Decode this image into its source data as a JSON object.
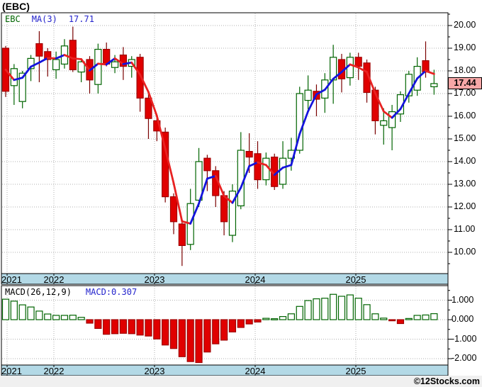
{
  "title": "(EBC)",
  "watermark": "©12Stocks.com",
  "main_chart": {
    "legend": {
      "symbol": "EBC",
      "ma_label": "MA(3)",
      "ma_value": "17.71"
    },
    "last_price_tag": "17.44",
    "price_axis": {
      "values": [
        20,
        19,
        18,
        17,
        16,
        15,
        14,
        13,
        12,
        11,
        10
      ],
      "labels": [
        "20.00",
        "19.00",
        "18.00",
        "17.00",
        "16.00",
        "15.00",
        "14.00",
        "13.00",
        "12.00",
        "11.00",
        "10.00"
      ]
    }
  },
  "macd_panel": {
    "legend": {
      "label": "MACD(26,12,9)",
      "value_label": "MACD:0.307"
    },
    "axis": {
      "values": [
        1,
        0,
        -1,
        -2
      ],
      "labels": [
        "1.000",
        "0.000",
        "-1.000",
        "-2.000"
      ]
    }
  },
  "x_axis": {
    "years": [
      "2021",
      "2022",
      "2023",
      "2024",
      "2025"
    ]
  },
  "colors": {
    "up_candle": "#006400",
    "down_candle": "#e00000",
    "down_candle_border": "#a00000",
    "down_wick": "#7a0000",
    "ma_up": "#1414dc",
    "ma_down": "#e82222",
    "band_bg": "#b3d9e6",
    "tag_bg": "#f6a7a7",
    "grid": "#b0b0b0",
    "legend_symbol": "#006600",
    "legend_blue": "#2222cc"
  },
  "chart_data": {
    "type": "candlestick+macd-bar",
    "title": "(EBC)",
    "ma_period": 3,
    "ma_last": 17.71,
    "macd_last": 0.307,
    "price_axis_range": [
      10,
      20
    ],
    "macd_axis_range": [
      -2,
      1
    ],
    "grid": "dotted",
    "months": [
      "2021-07",
      "2021-08",
      "2021-09",
      "2021-10",
      "2021-11",
      "2021-12",
      "2022-01",
      "2022-02",
      "2022-03",
      "2022-04",
      "2022-05",
      "2022-06",
      "2022-07",
      "2022-08",
      "2022-09",
      "2022-10",
      "2022-11",
      "2022-12",
      "2023-01",
      "2023-02",
      "2023-03",
      "2023-04",
      "2023-05",
      "2023-06",
      "2023-07",
      "2023-08",
      "2023-09",
      "2023-10",
      "2023-11",
      "2023-12",
      "2024-01",
      "2024-02",
      "2024-03",
      "2024-04",
      "2024-05",
      "2024-06",
      "2024-07",
      "2024-08",
      "2024-09",
      "2024-10",
      "2024-11",
      "2024-12",
      "2025-01",
      "2025-02",
      "2025-03",
      "2025-04",
      "2025-05",
      "2025-06",
      "2025-07",
      "2025-08",
      "2025-09",
      "2025-10"
    ],
    "ohlc": [
      [
        19.0,
        19.1,
        16.85,
        17.1
      ],
      [
        17.35,
        18.3,
        16.5,
        18.1
      ],
      [
        16.65,
        18.0,
        16.35,
        17.9
      ],
      [
        18.1,
        18.7,
        17.55,
        18.55
      ],
      [
        19.2,
        19.75,
        17.5,
        18.65
      ],
      [
        18.85,
        19.0,
        17.75,
        18.5
      ],
      [
        18.05,
        18.85,
        17.65,
        18.5
      ],
      [
        18.3,
        19.4,
        18.1,
        19.1
      ],
      [
        19.35,
        19.95,
        17.95,
        18.05
      ],
      [
        17.95,
        18.55,
        17.5,
        18.4
      ],
      [
        18.5,
        18.65,
        17.0,
        17.6
      ],
      [
        17.4,
        19.2,
        17.0,
        18.95
      ],
      [
        18.95,
        19.25,
        18.2,
        18.3
      ],
      [
        18.15,
        18.7,
        17.9,
        18.4
      ],
      [
        18.7,
        19.05,
        17.6,
        18.2
      ],
      [
        18.2,
        18.65,
        17.7,
        18.5
      ],
      [
        18.6,
        18.75,
        16.2,
        16.8
      ],
      [
        16.8,
        17.1,
        15.0,
        15.9
      ],
      [
        15.8,
        16.1,
        14.9,
        15.35
      ],
      [
        15.3,
        15.5,
        12.2,
        12.45
      ],
      [
        12.45,
        12.6,
        10.8,
        11.35
      ],
      [
        11.25,
        11.4,
        9.4,
        10.3
      ],
      [
        10.35,
        12.8,
        10.1,
        12.15
      ],
      [
        12.3,
        14.6,
        12.0,
        14.0
      ],
      [
        14.15,
        14.3,
        12.7,
        13.6
      ],
      [
        13.6,
        13.8,
        12.0,
        12.5
      ],
      [
        12.5,
        12.7,
        10.75,
        11.35
      ],
      [
        10.75,
        13.0,
        10.45,
        12.7
      ],
      [
        12.05,
        15.3,
        11.9,
        14.5
      ],
      [
        14.45,
        15.25,
        13.5,
        14.2
      ],
      [
        14.35,
        14.9,
        12.8,
        13.2
      ],
      [
        13.2,
        14.4,
        12.95,
        14.15
      ],
      [
        14.2,
        14.35,
        12.75,
        12.9
      ],
      [
        13.0,
        14.9,
        12.8,
        14.15
      ],
      [
        14.15,
        15.05,
        13.6,
        14.5
      ],
      [
        14.5,
        17.3,
        14.35,
        17.0
      ],
      [
        16.7,
        17.8,
        16.3,
        17.15
      ],
      [
        17.1,
        17.4,
        16.0,
        16.75
      ],
      [
        16.8,
        17.9,
        16.15,
        17.6
      ],
      [
        17.6,
        19.15,
        16.55,
        18.6
      ],
      [
        18.5,
        18.75,
        17.05,
        17.65
      ],
      [
        17.7,
        18.8,
        17.35,
        18.6
      ],
      [
        18.6,
        18.8,
        17.6,
        18.2
      ],
      [
        18.35,
        18.5,
        16.6,
        17.05
      ],
      [
        17.15,
        17.3,
        15.2,
        15.8
      ],
      [
        15.6,
        16.35,
        14.75,
        15.8
      ],
      [
        15.5,
        16.5,
        14.5,
        16.2
      ],
      [
        16.1,
        17.1,
        15.75,
        16.95
      ],
      [
        16.9,
        18.0,
        16.6,
        17.85
      ],
      [
        17.15,
        18.6,
        16.9,
        18.2
      ],
      [
        18.45,
        19.3,
        17.7,
        17.95
      ],
      [
        17.3,
        18.05,
        16.95,
        17.44
      ]
    ],
    "macd": [
      1.05,
      0.95,
      0.76,
      0.65,
      0.44,
      0.29,
      0.22,
      0.22,
      0.23,
      0.12,
      -0.18,
      -0.45,
      -0.75,
      -0.72,
      -0.7,
      -0.72,
      -0.79,
      -0.84,
      -0.99,
      -1.3,
      -1.48,
      -1.9,
      -2.15,
      -2.2,
      -1.66,
      -1.24,
      -1.05,
      -0.63,
      -0.4,
      -0.22,
      -0.12,
      0.07,
      0.05,
      0.16,
      0.3,
      0.68,
      0.98,
      1.07,
      1.1,
      1.3,
      1.2,
      1.27,
      1.1,
      0.77,
      0.3,
      0.08,
      -0.04,
      -0.2,
      0.06,
      0.22,
      0.24,
      0.307
    ]
  }
}
